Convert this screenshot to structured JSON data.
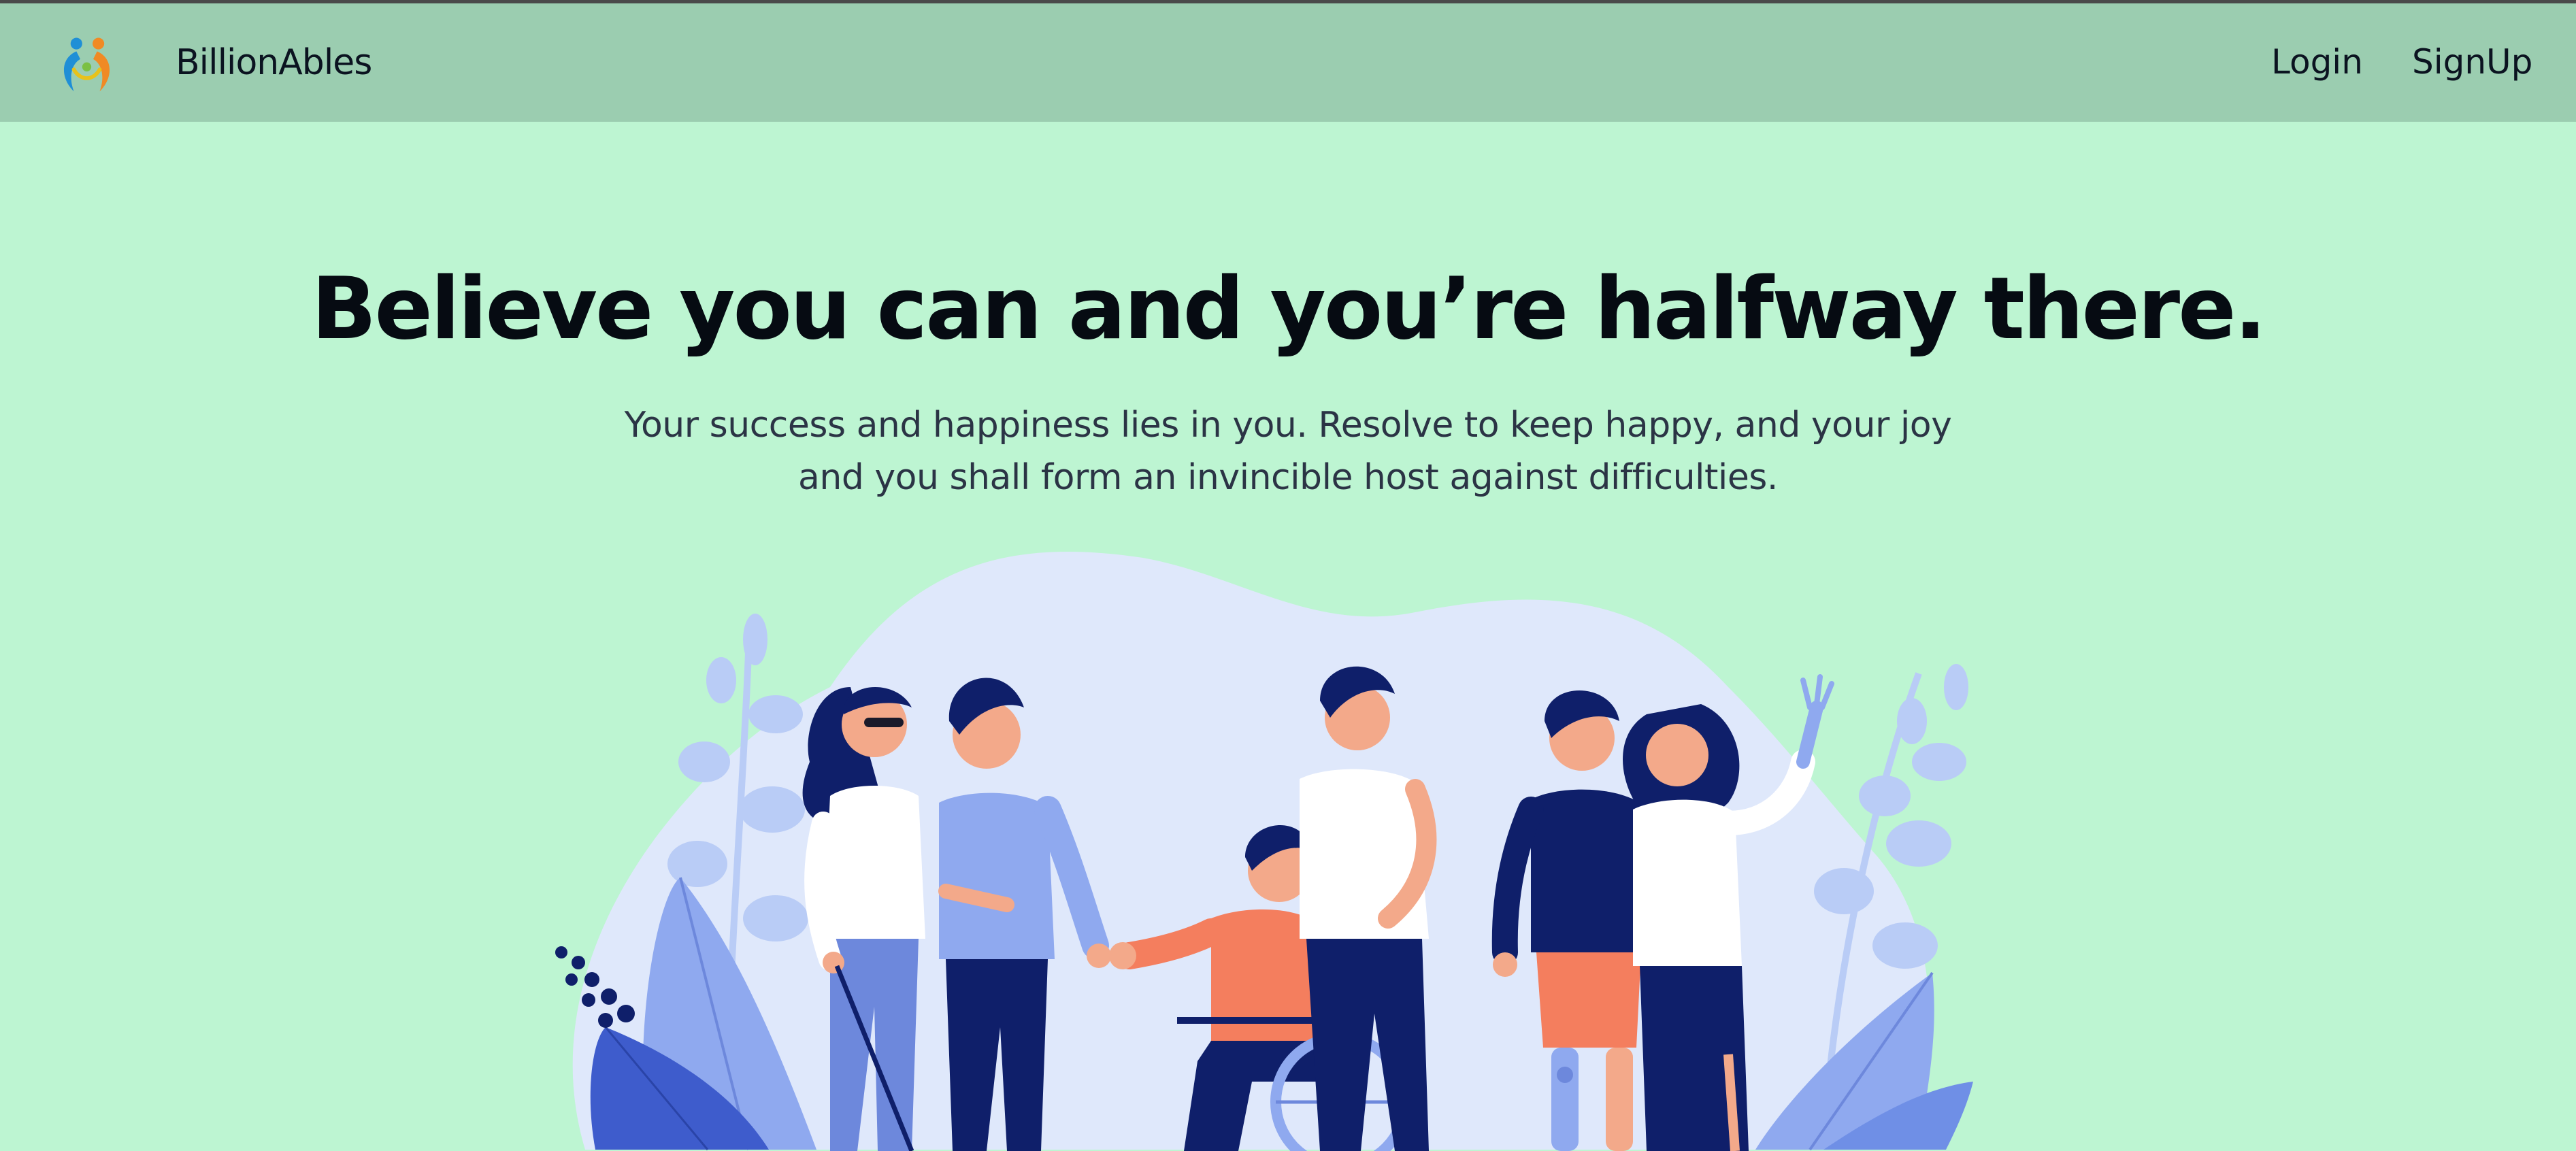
{
  "navbar": {
    "brand": "BillionAbles",
    "links": [
      {
        "label": "Login"
      },
      {
        "label": "SignUp"
      }
    ]
  },
  "hero": {
    "headline": "Believe you can and you’re halfway there.",
    "subtext_line1": "Your success and happiness lies in you. Resolve to keep happy, and your joy",
    "subtext_line2": "and you shall form an invincible host against difficulties."
  },
  "colors": {
    "page_background": "#bdf5d2",
    "navbar_background": "#9bcdb0",
    "illustration_blob": "#dfe8fb",
    "leaf_light": "#b9ccf6",
    "leaf_mid": "#8fa9ef",
    "leaf_dark": "#3e5ccc",
    "navy": "#0f1f6a",
    "coral": "#f47e5e"
  }
}
